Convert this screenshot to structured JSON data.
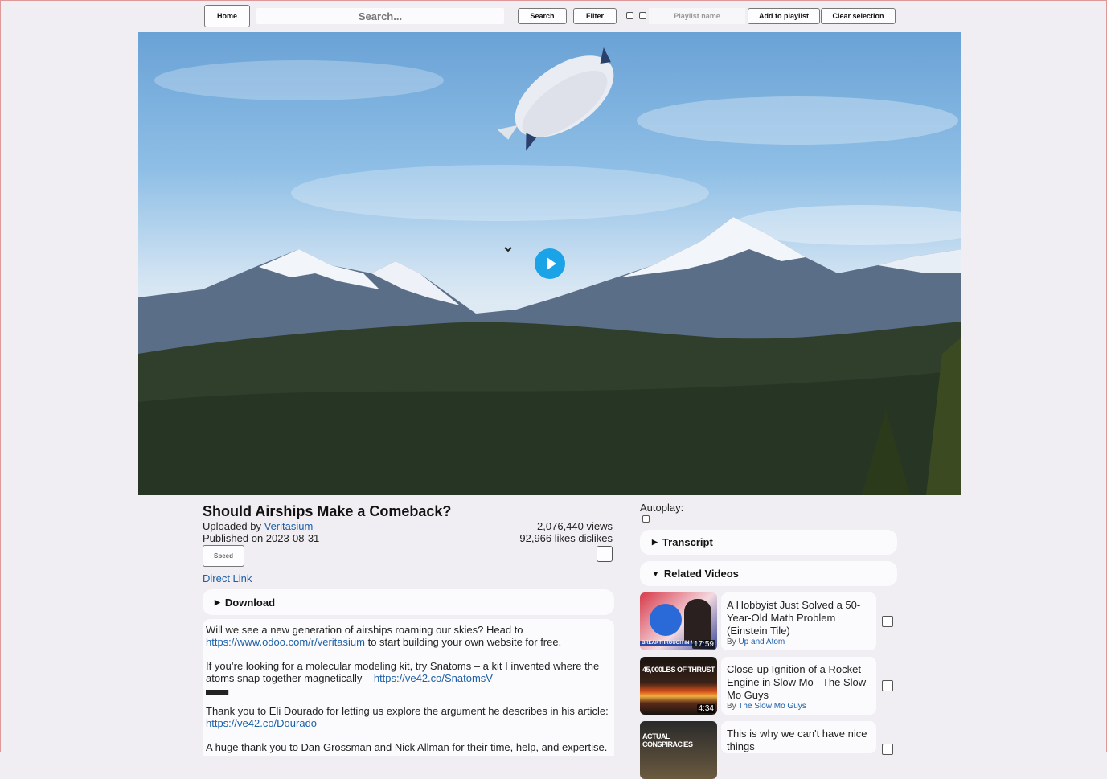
{
  "toolbar": {
    "home_label": "Home",
    "search_placeholder": "Search...",
    "search_button": "Search",
    "filter_button": "Filter",
    "playlist_placeholder": "Playlist name",
    "add_to_playlist": "Add to playlist",
    "clear_selection": "Clear selection"
  },
  "video": {
    "title": "Should Airships Make a Comeback?",
    "uploaded_by_prefix": "Uploaded by ",
    "uploader": "Veritasium",
    "published": "Published on 2023-08-31",
    "views": "2,076,440 views",
    "likes": "92,966 likes dislikes",
    "speed_label": "Speed",
    "direct_link": "Direct Link",
    "download_label": "Download"
  },
  "description": {
    "p1_text": "Will we see a new generation of airships roaming our skies? Head to",
    "p1_link": "https://www.odoo.com/r/veritasium",
    "p1_tail": " to start building your own website for free.",
    "p2_text": "If you’re looking for a molecular modeling kit, try Snatoms – a kit I invented where the atoms snap together magnetically – ",
    "p2_link": "https://ve42.co/SnatomsV",
    "divider": "▀▀▀▀",
    "p3_text": "Thank you to Eli Dourado for letting us explore the argument he describes in his article:",
    "p3_link": "https://ve42.co/Dourado",
    "p4_text": "A huge thank you to Dan Grossman and Nick Allman for their time, help, and expertise."
  },
  "sidebar": {
    "autoplay_label": "Autoplay:",
    "transcript_label": "Transcript",
    "related_label": "Related Videos",
    "by_prefix": "By ",
    "related": [
      {
        "title": "A Hobbyist Just Solved a 50-Year-Old Math Problem (Einstein Tile)",
        "channel": "Up and Atom",
        "duration": "17:59",
        "thumb_text": "BREAKTHROUGH IN MATH"
      },
      {
        "title": "Close-up Ignition of a Rocket Engine in Slow Mo - The Slow Mo Guys",
        "channel": "The Slow Mo Guys",
        "duration": "4:34",
        "thumb_text": "45,000LBS OF THRUST"
      },
      {
        "title": "This is why we can't have nice things",
        "channel": "",
        "duration": "",
        "thumb_text": "ACTUAL CONSPIRACIES"
      }
    ]
  },
  "colors": {
    "link": "#1a5fa8",
    "play_button": "#1aa3e6",
    "background": "#f0eef2"
  }
}
